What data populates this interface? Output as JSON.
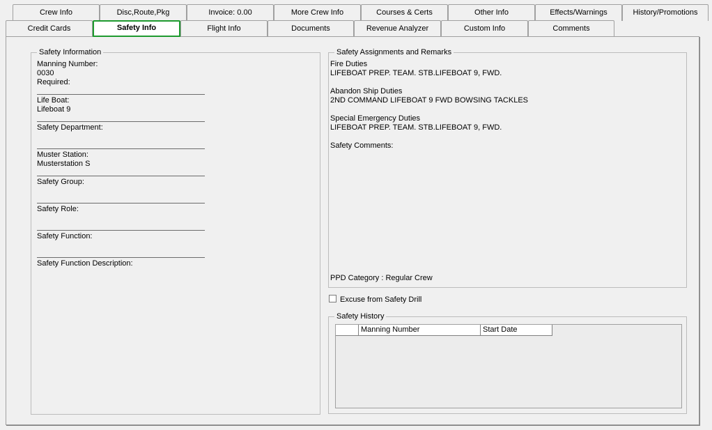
{
  "tabs_row1": [
    {
      "label": "Crew Info"
    },
    {
      "label": "Disc,Route,Pkg"
    },
    {
      "label": "Invoice: 0.00"
    },
    {
      "label": "More Crew Info"
    },
    {
      "label": "Courses & Certs"
    },
    {
      "label": "Other Info"
    },
    {
      "label": "Effects/Warnings"
    },
    {
      "label": "History/Promotions"
    }
  ],
  "tabs_row2": [
    {
      "label": "Credit Cards"
    },
    {
      "label": "Safety Info",
      "active": true
    },
    {
      "label": "Flight Info"
    },
    {
      "label": "Documents"
    },
    {
      "label": "Revenue Analyzer"
    },
    {
      "label": "Custom Info"
    },
    {
      "label": "Comments"
    }
  ],
  "safety_info": {
    "legend": "Safety Information",
    "manning_number_label": "Manning Number:",
    "manning_number_value": "0030",
    "required_label": "Required:",
    "required_value": "",
    "life_boat_label": "Life Boat:",
    "life_boat_value": "Lifeboat 9",
    "safety_department_label": "Safety Department:",
    "safety_department_value": "",
    "muster_station_label": "Muster Station:",
    "muster_station_value": "Musterstation S",
    "safety_group_label": "Safety Group:",
    "safety_group_value": "",
    "safety_role_label": "Safety Role:",
    "safety_role_value": "",
    "safety_function_label": "Safety Function:",
    "safety_function_value": "",
    "safety_function_description_label": "Safety Function Description:",
    "safety_function_description_value": ""
  },
  "assignments": {
    "legend": "Safety Assignments and Remarks",
    "fire_duties_label": "Fire Duties",
    "fire_duties_value": "LIFEBOAT PREP. TEAM. STB.LIFEBOAT 9, FWD.",
    "abandon_ship_label": "Abandon Ship Duties",
    "abandon_ship_value": "2ND COMMAND LIFEBOAT 9 FWD BOWSING TACKLES",
    "special_emergency_label": "Special Emergency Duties",
    "special_emergency_value": "LIFEBOAT PREP. TEAM. STB.LIFEBOAT 9, FWD.",
    "safety_comments_label": "Safety Comments:",
    "ppd_category": "PPD Category : Regular Crew"
  },
  "excuse_drill": {
    "label": "Excuse from Safety Drill",
    "checked": false
  },
  "safety_history": {
    "legend": "Safety History",
    "columns": [
      "Manning Number",
      "Start Date"
    ]
  }
}
